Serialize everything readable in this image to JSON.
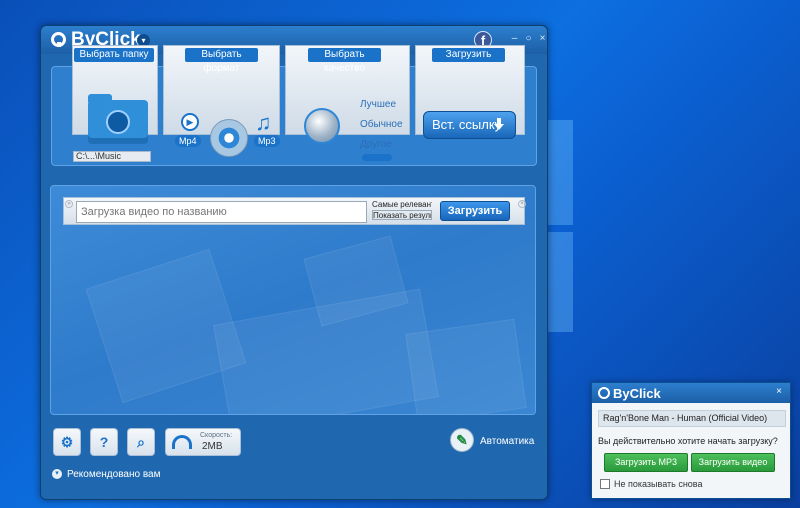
{
  "app": {
    "title": "ByClick",
    "facebook_glyph": "f",
    "controls": {
      "minimize": "–",
      "restore": "○",
      "close": "×"
    }
  },
  "toolbar": {
    "folder": {
      "label": "Выбрать папку",
      "path": "C:\\...\\Music"
    },
    "format": {
      "label": "Выбрать формат",
      "mp4": "Mp4",
      "mp3": "Mp3"
    },
    "quality": {
      "label": "Выбрать качество",
      "best": "Лучшее",
      "normal": "Обычное",
      "other": "Другое"
    },
    "paste": {
      "label": "Загрузить",
      "button": "Вст. ссылку"
    }
  },
  "search": {
    "placeholder": "Загрузка видео по названию",
    "option_relevant": "Самые релевантные",
    "option_results": "Показать результаты",
    "download_button": "Загрузить"
  },
  "bottom": {
    "settings_icon": "gear-icon",
    "help_label": "?",
    "search_icon": "magnifier-icon",
    "speed_label": "Скорость:",
    "speed_value": "2MB",
    "auto_label": "Автоматика",
    "recommended_label": "Рекомендовано вам"
  },
  "popup": {
    "title": "ByClick",
    "video": "Rag'n'Bone Man - Human (Official Video)",
    "question": "Вы действительно хотите начать загрузку?",
    "mp3_button": "Загрузить MP3",
    "video_button": "Загрузить видео",
    "dont_show": "Не показывать снова",
    "close": "×"
  },
  "colors": {
    "accent": "#1a73c9",
    "green": "#2a9a3a",
    "desktop": "#0b5fd0"
  }
}
